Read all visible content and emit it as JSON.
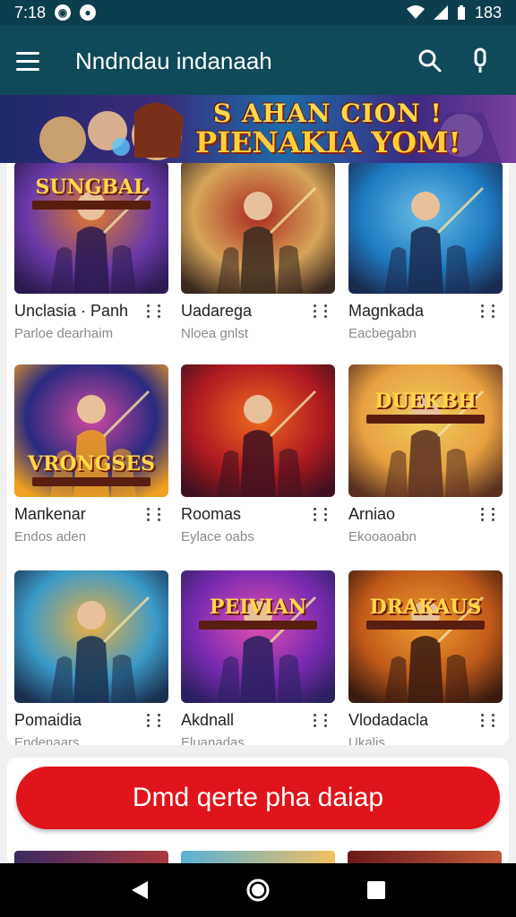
{
  "status_bar": {
    "time": "7:18",
    "battery": "183"
  },
  "app_bar": {
    "title": "Nndndau indanaah"
  },
  "banner": {
    "line1": "S AHAN CION !",
    "line2": "PIENAKIA YOM!"
  },
  "games": [
    {
      "title": "Unclasia · Panh",
      "subtitle": "Parloe dearhaim",
      "thumb_text": "SUNGBAL",
      "colors": [
        "#6a3aa8",
        "#e07a2a",
        "#2a1a50"
      ]
    },
    {
      "title": "Uadarega",
      "subtitle": "Nloea gnlst",
      "thumb_text": "",
      "colors": [
        "#d7a45a",
        "#a82a1e",
        "#3a2a20"
      ]
    },
    {
      "title": "Magnkada",
      "subtitle": "Eacbegabn",
      "thumb_text": "",
      "colors": [
        "#1f7ac0",
        "#6ac0e8",
        "#1a2a50"
      ]
    },
    {
      "title": "Maпkenar",
      "subtitle": "Endos aden",
      "thumb_text": "VRONGSES",
      "colors": [
        "#2a2a80",
        "#d04aa0",
        "#f0a020"
      ]
    },
    {
      "title": "Roomas",
      "subtitle": "Eylace oabs",
      "thumb_text": "",
      "colors": [
        "#b01a20",
        "#f06a20",
        "#401020"
      ]
    },
    {
      "title": "Arniao",
      "subtitle": "Ekooaoabn",
      "thumb_text": "DUEKBH",
      "colors": [
        "#e8a040",
        "#f0d060",
        "#5a3020"
      ]
    },
    {
      "title": "Pomaidia",
      "subtitle": "Endenaars",
      "thumb_text": "",
      "colors": [
        "#3a9ac8",
        "#f0b040",
        "#1a3050"
      ]
    },
    {
      "title": "Akdnall",
      "subtitle": "Eluanadas",
      "thumb_text": "PEIVIAN",
      "colors": [
        "#7a2ab0",
        "#e050b0",
        "#2a2060"
      ]
    },
    {
      "title": "Vlodadacla",
      "subtitle": "Ukalis",
      "thumb_text": "DRAKAUS",
      "colors": [
        "#c05a1a",
        "#f0a030",
        "#3a1a10"
      ]
    }
  ],
  "cta": {
    "label": "Dmd qerte pha daiap"
  },
  "icons": {
    "menu": "menu-icon",
    "search": "search-icon",
    "mic": "mic-icon",
    "back": "back-icon",
    "home": "home-icon",
    "recents": "recents-icon"
  },
  "colors": {
    "app_bar": "#0e4a5a",
    "status_bar": "#0b3f4d",
    "cta": "#e0141b"
  }
}
